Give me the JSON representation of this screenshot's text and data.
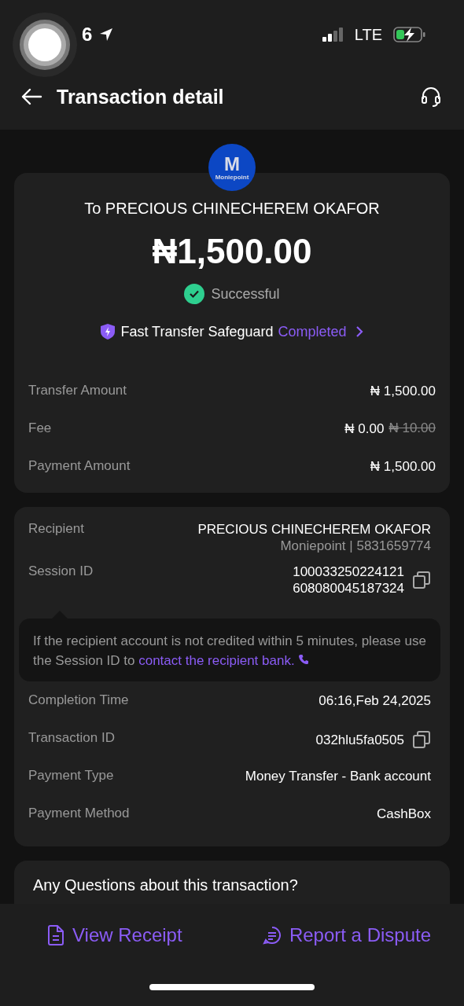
{
  "status_bar": {
    "time": "6",
    "network": "LTE"
  },
  "header": {
    "title": "Transaction detail"
  },
  "summary": {
    "logo": {
      "letter": "M",
      "name": "Moniepoint"
    },
    "recipient_line": "To PRECIOUS CHINECHEREM OKAFOR",
    "amount": "₦1,500.00",
    "status": {
      "label": "Successful",
      "success": true
    },
    "safeguard": {
      "label": "Fast Transfer Safeguard",
      "state": "Completed"
    },
    "rows": [
      {
        "label": "Transfer Amount",
        "value": "₦ 1,500.00"
      },
      {
        "label": "Fee",
        "value": "₦ 0.00",
        "old_value": "₦ 10.00"
      },
      {
        "label": "Payment Amount",
        "value": "₦ 1,500.00"
      }
    ]
  },
  "details": {
    "rows": [
      {
        "label": "Recipient",
        "value": "PRECIOUS CHINECHEREM OKAFOR",
        "sub": "Moniepoint | 5831659774",
        "copyable": false
      },
      {
        "label": "Session ID",
        "value": "100033250224121 608080045187324",
        "copyable": true,
        "tooltip": {
          "text": "If the recipient account is not credited within 5 minutes, please use the Session ID to",
          "link": "contact the recipient bank."
        }
      },
      {
        "label": "Completion Time",
        "value": "06:16,Feb 24,2025",
        "copyable": false
      },
      {
        "label": "Transaction ID",
        "value": "032hlu5fa0505",
        "copyable": true
      },
      {
        "label": "Payment Type",
        "value": "Money Transfer - Bank account",
        "copyable": false
      },
      {
        "label": "Payment Method",
        "value": "CashBox",
        "copyable": false
      }
    ]
  },
  "questions": {
    "title": "Any Questions about this transaction?"
  },
  "actions": [
    {
      "kind": "receipt",
      "label": "View Receipt"
    },
    {
      "kind": "dispute",
      "label": "Report a Dispute"
    }
  ]
}
